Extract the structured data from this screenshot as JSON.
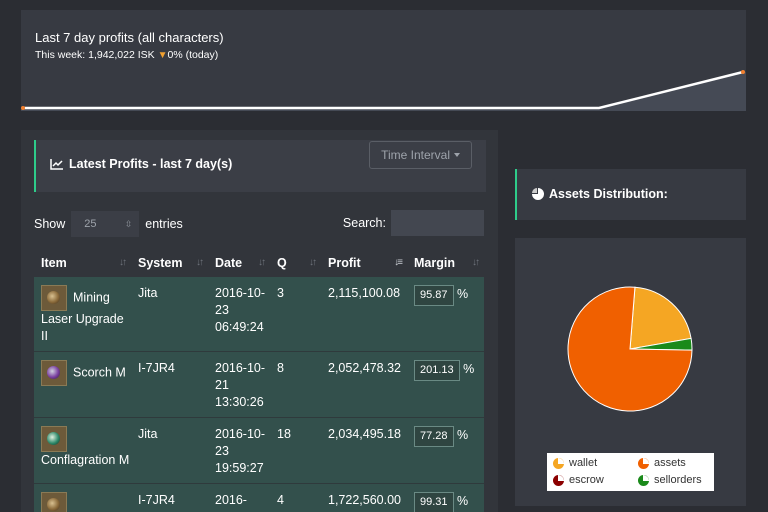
{
  "profits_summary": {
    "title": "Last 7 day profits (all characters)",
    "week_label": "This week: 1,942,022 ISK",
    "change_text": "0% (today)",
    "change_icon": "triangle-down-icon"
  },
  "latest_profits": {
    "title": "Latest Profits - last 7 day(s)",
    "time_interval_label": "Time Interval",
    "show_label": "Show",
    "entries_value": "25",
    "entries_label": "entries",
    "search_label": "Search:",
    "columns": [
      "Item",
      "System",
      "Date",
      "Q",
      "Profit",
      "Margin"
    ],
    "rows": [
      {
        "item": "Mining Laser Upgrade II",
        "system": "Jita",
        "date": "2016-10-23 06:49:24",
        "q": "3",
        "profit": "2,115,100.08",
        "margin": "95.87",
        "pct": "%"
      },
      {
        "item": "Scorch M",
        "system": "I-7JR4",
        "date": "2016-10-21 13:30:26",
        "q": "8",
        "profit": "2,052,478.32",
        "margin": "201.13",
        "pct": "%"
      },
      {
        "item": "Conflagration M",
        "system": "Jita",
        "date": "2016-10-23 19:59:27",
        "q": "18",
        "profit": "2,034,495.18",
        "margin": "77.28",
        "pct": "%"
      },
      {
        "item": "",
        "system": "I-7JR4",
        "date": "2016-",
        "q": "4",
        "profit": "1,722,560.00",
        "margin": "99.31",
        "pct": "%"
      }
    ]
  },
  "assets": {
    "title": "Assets Distribution:",
    "legend": [
      "wallet",
      "assets",
      "escrow",
      "sellorders"
    ],
    "colors": {
      "wallet": "#f5a623",
      "assets": "#f06000",
      "escrow": "#8b0000",
      "sellorders": "#1a8a1a"
    },
    "shares": {
      "wallet": 0.21,
      "assets": 0.76,
      "escrow": 0.0,
      "sellorders": 0.03
    }
  },
  "accent_color": "#2ecc8a"
}
